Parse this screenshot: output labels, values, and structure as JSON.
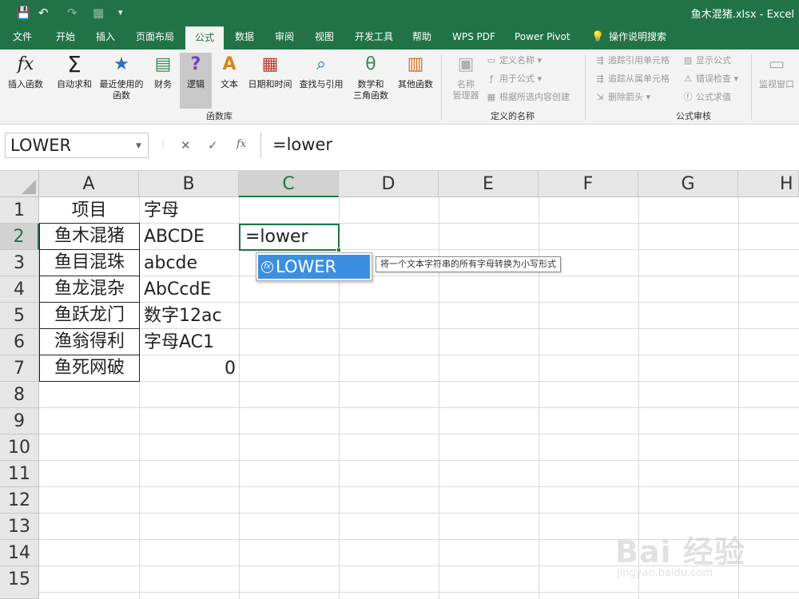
{
  "titlebar": {
    "title": "鱼木混猪.xlsx  -  Excel",
    "save_icon": "💾",
    "undo_icon": "↶",
    "redo_icon": "↷",
    "form_icon": "▦",
    "customize_icon": "▾"
  },
  "tabs": [
    "文件",
    "开始",
    "插入",
    "页面布局",
    "公式",
    "数据",
    "审阅",
    "视图",
    "开发工具",
    "帮助",
    "WPS PDF",
    "Power Pivot",
    "操作说明搜索"
  ],
  "ribbon": {
    "insert_function": "插入函数",
    "autosum": "自动求和",
    "recent": "最近使用的",
    "recent2": "函数",
    "finance": "财务",
    "logic": "逻辑",
    "text": "文本",
    "datetime": "日期和时间",
    "lookup": "查找与引用",
    "math": "数学和",
    "math2": "三角函数",
    "other": "其他函数",
    "group_library": "函数库",
    "name_manager": "名称",
    "name_manager2": "管理器",
    "define_name": "定义名称",
    "use_in_formula": "用于公式",
    "create_from_selection": "根据所选内容创建",
    "group_names": "定义的名称",
    "trace_precedents": "追踪引用单元格",
    "trace_dependents": "追踪从属单元格",
    "remove_arrows": "删除箭头",
    "show_formulas": "显示公式",
    "error_checking": "错误检查",
    "evaluate_formula": "公式求值",
    "group_audit": "公式审核",
    "watch_window": "监视窗口"
  },
  "formula_bar": {
    "name_box": "LOWER",
    "cancel_icon": "✕",
    "enter_icon": "✓",
    "fx_icon": "fx",
    "formula": "=lower"
  },
  "columns": [
    "A",
    "B",
    "C",
    "D",
    "E",
    "F",
    "G",
    "H"
  ],
  "rows": [
    "1",
    "2",
    "3",
    "4",
    "5",
    "6",
    "7",
    "8",
    "9",
    "10",
    "11",
    "12",
    "13",
    "14",
    "15"
  ],
  "cells": {
    "A1": "项目",
    "B1": "字母",
    "A2": "鱼木混猪",
    "B2": "ABCDE",
    "A3": "鱼目混珠",
    "B3": "abcde",
    "A4": "鱼龙混杂",
    "B4": "AbCcdE",
    "A5": "鱼跃龙门",
    "B5": "数字12ac",
    "A6": "渔翁得利",
    "B6": "字母AC1",
    "A7": "鱼死网破",
    "B7": "0",
    "C2": "=lower"
  },
  "autocomplete": {
    "item": "LOWER",
    "icon": "fx",
    "tooltip": "将一个文本字符串的所有字母转换为小写形式"
  },
  "watermark": {
    "main": "Bai 经验",
    "sub": "jingyan.baidu.com"
  }
}
